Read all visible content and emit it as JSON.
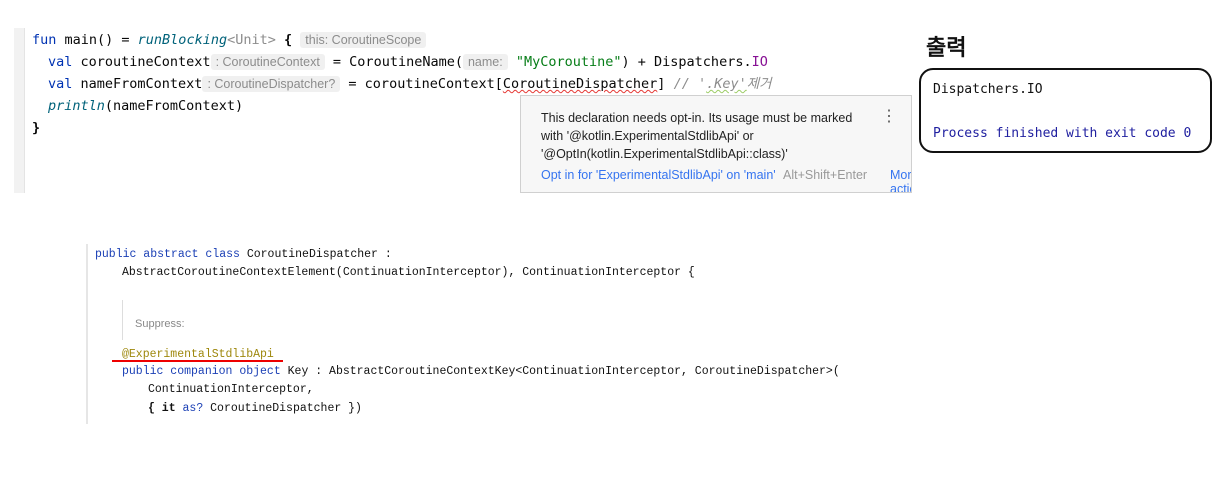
{
  "editor": {
    "line1": {
      "kw": "fun",
      "name": " main() = ",
      "call": "runBlocking",
      "generic": "<Unit>",
      "brace": " {",
      "hint": "this: CoroutineScope"
    },
    "line2": {
      "kw": "val",
      "name": " coroutineContext",
      "hint": ": CoroutineContext",
      "eq": " = CoroutineName(",
      "param_hint": "name:",
      "str": "\"MyCoroutine\"",
      "rest": ") + Dispatchers.",
      "io": "IO"
    },
    "line3": {
      "kw": "val",
      "name": " nameFromContext",
      "hint": ": CoroutineDispatcher?",
      "eq": " = coroutineContext[",
      "err": "CoroutineDispatcher",
      "close": "]",
      "comment_pre": " // '",
      "comment_key": ".Key'",
      "comment_post": "제거"
    },
    "line4": {
      "call": "println",
      "rest": "(nameFromContext)"
    },
    "line5": "}"
  },
  "popup": {
    "message": "This declaration needs opt-in. Its usage must be marked with '@kotlin.ExperimentalStdlibApi' or '@OptIn(kotlin.ExperimentalStdlibApi::class)'",
    "action": "Opt in for 'ExperimentalStdlibApi' on 'main'",
    "shortcut": "Alt+Shift+Enter",
    "more": "More actions",
    "menu_icon": "⋮"
  },
  "output": {
    "title": "출력",
    "line1": "Dispatchers.IO",
    "line2": "Process finished with exit code 0"
  },
  "source": {
    "l1_kw": "public abstract class",
    "l1_rest": " CoroutineDispatcher :",
    "l2": "AbstractCoroutineContextElement(ContinuationInterceptor), ContinuationInterceptor {",
    "suppress": "Suppress:",
    "annotation": "@ExperimentalStdlibApi",
    "l4_kw": "public companion object",
    "l4_rest": " Key : AbstractCoroutineContextKey<ContinuationInterceptor, CoroutineDispatcher>(",
    "l5": "ContinuationInterceptor,",
    "l6_a": "{ it ",
    "l6_kw": "as?",
    "l6_b": " CoroutineDispatcher })"
  }
}
